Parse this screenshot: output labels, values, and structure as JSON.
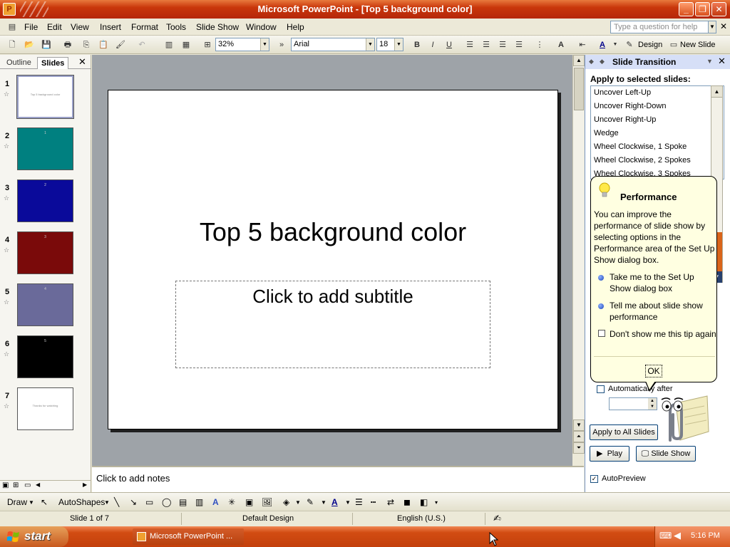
{
  "window": {
    "title": "Microsoft PowerPoint - [Top 5 background color]",
    "app_icon": "powerpoint-icon"
  },
  "menu": {
    "items": [
      "File",
      "Edit",
      "View",
      "Insert",
      "Format",
      "Tools",
      "Slide Show",
      "Window",
      "Help"
    ],
    "help_placeholder": "Type a question for help"
  },
  "toolbar": {
    "zoom": "32%",
    "font": "Arial",
    "font_size": "18",
    "design_label": "Design",
    "new_slide_label": "New Slide"
  },
  "left_pane": {
    "tab_outline": "Outline",
    "tab_slides": "Slides",
    "slides": [
      {
        "num": "1",
        "color": "#ffffff",
        "label": "Top 5 background color"
      },
      {
        "num": "2",
        "color": "#008080",
        "label": "1"
      },
      {
        "num": "3",
        "color": "#0a0a9a",
        "label": "2"
      },
      {
        "num": "4",
        "color": "#7a0a0a",
        "label": "3"
      },
      {
        "num": "5",
        "color": "#6a6a9a",
        "label": "4"
      },
      {
        "num": "6",
        "color": "#000000",
        "label": "5"
      },
      {
        "num": "7",
        "color": "#ffffff",
        "label": "Thanks for watching"
      }
    ]
  },
  "slide": {
    "title": "Top 5 background color",
    "subtitle_placeholder": "Click to add subtitle"
  },
  "notes": {
    "placeholder": "Click to add notes"
  },
  "task_pane": {
    "title": "Slide Transition",
    "apply_label": "Apply to selected slides:",
    "transitions": [
      "Uncover Left-Up",
      "Uncover Right-Down",
      "Uncover Right-Up",
      "Wedge",
      "Wheel Clockwise, 1 Spoke",
      "Wheel Clockwise, 2 Spokes",
      "Wheel Clockwise, 3 Spokes"
    ],
    "auto_after_label": "Automatically after",
    "apply_all_label": "Apply to All Slides",
    "play_label": "Play",
    "slideshow_label": "Slide Show",
    "autopreview_label": "AutoPreview"
  },
  "balloon": {
    "title": "Performance",
    "body": "You can improve the performance of slide show by selecting options in the Performance area of the Set Up Show dialog box.",
    "option1": "Take me to the Set Up Show dialog box",
    "option2": "Tell me about slide show performance",
    "option3": "Don't show me this tip again",
    "ok_label": "OK"
  },
  "drawing": {
    "draw_label": "Draw",
    "autoshapes_label": "AutoShapes"
  },
  "status": {
    "slide_of": "Slide 1 of 7",
    "design": "Default Design",
    "language": "English (U.S.)"
  },
  "taskbar": {
    "start_label": "start",
    "task_item": "Microsoft PowerPoint ...",
    "clock": "5:16 PM"
  },
  "colors": {
    "title_bar": "#c9370b",
    "task_pane_header": "#d6dff7",
    "slide_area_bg": "#9ea3a8"
  }
}
